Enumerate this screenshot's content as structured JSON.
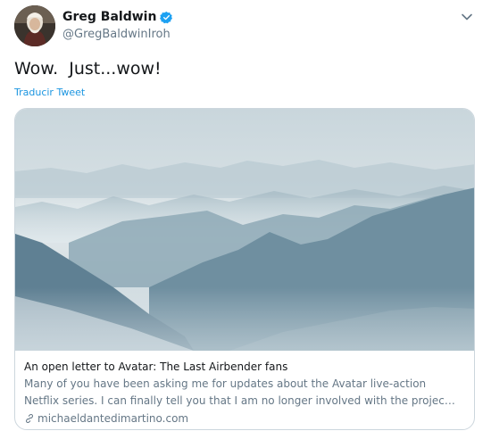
{
  "author": {
    "name": "Greg Baldwin",
    "handle": "@GregBaldwinIroh",
    "avatar_icon": "profile-photo",
    "verified_icon": "verified-badge-icon"
  },
  "tweet": {
    "text": "Wow.  Just...wow!",
    "translate_label": "Traducir Tweet"
  },
  "card": {
    "image_icon": "misty-mountains-photo",
    "title": "An open letter to Avatar: The Last Airbender fans",
    "description_lines": [
      "Many of you have been asking me for updates about the Avatar live-action",
      "Netflix series. I can finally tell you that I am no longer involved with the projec…"
    ],
    "link_icon": "link-icon",
    "domain": "michaeldantedimartino.com"
  },
  "menu_icon": "chevron-down-icon",
  "colors": {
    "link": "#1b95e0",
    "verified": "#1da1f2",
    "secondary_text": "#657786",
    "border": "#ccd6dd"
  }
}
